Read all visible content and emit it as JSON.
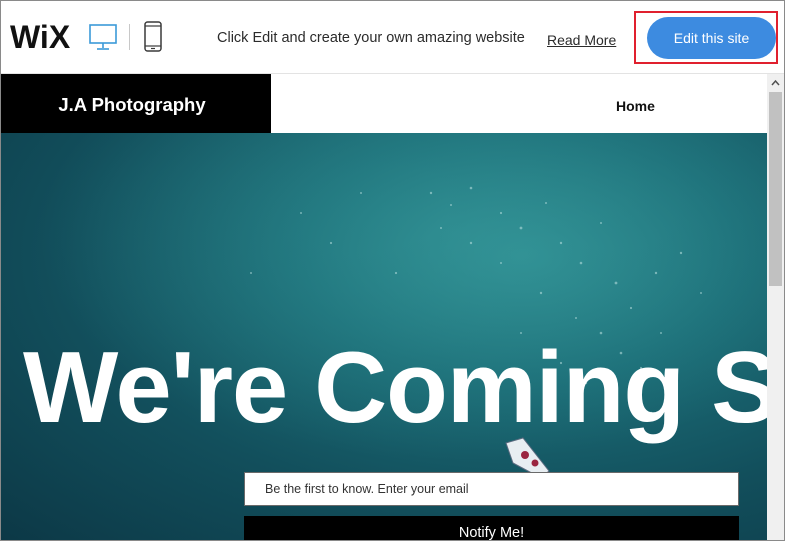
{
  "wix_bar": {
    "logo_text": "WiX",
    "desktop_view_icon": "desktop-icon",
    "mobile_view_icon": "mobile-icon",
    "promo_text": "Click Edit and create your own amazing website",
    "read_more_label": "Read More",
    "edit_button_label": "Edit this site",
    "colors": {
      "button": "#3d8be0",
      "highlight": "#e0202e",
      "desktop_icon": "#3b9ad9"
    }
  },
  "site_header": {
    "brand_name": "J.A Photography",
    "nav_items": [
      {
        "label": "Home"
      }
    ]
  },
  "hero": {
    "headline": "We're Coming S",
    "email_placeholder": "Be the first to know. Enter your email",
    "notify_label": "Notify Me!"
  },
  "scrollbar": {
    "up_icon": "chevron-up-icon"
  }
}
